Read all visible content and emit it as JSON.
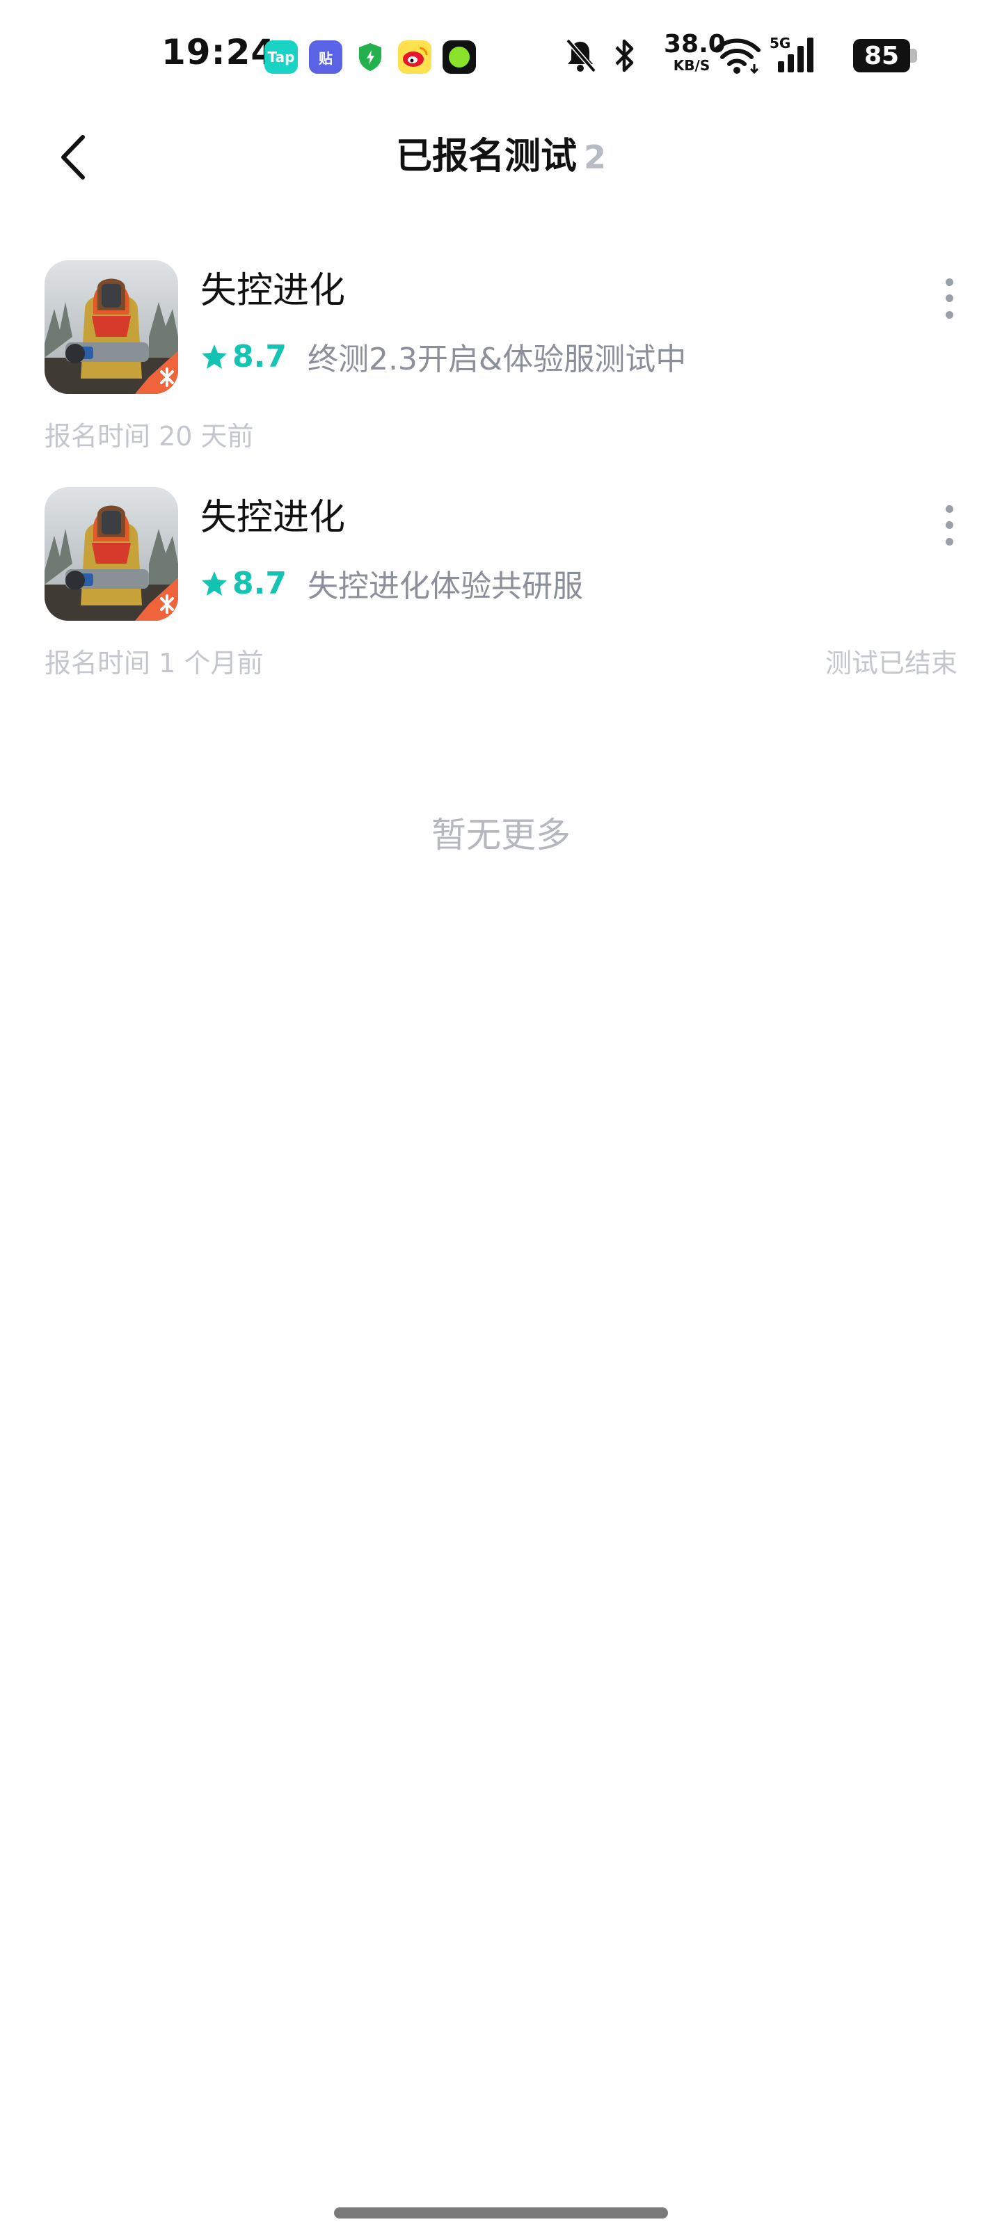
{
  "status_bar": {
    "time": "19:24",
    "notification_icons": [
      {
        "name": "tap-app-icon",
        "text": "Tap",
        "color": "#19d3c5"
      },
      {
        "name": "tieba-app-icon",
        "text": "贴",
        "color": "#4b5be0"
      },
      {
        "name": "shield-app-icon",
        "text": "",
        "color": "#22b14c"
      },
      {
        "name": "weibo-app-icon",
        "text": "",
        "color": "#f5a623"
      },
      {
        "name": "green-dot-app-icon",
        "text": "",
        "color": "#111111"
      }
    ],
    "net_speed_value": "38.0",
    "net_speed_unit": "KB/S",
    "network": "5G",
    "battery": "85"
  },
  "nav": {
    "title": "已报名测试",
    "count": "2"
  },
  "games": [
    {
      "title": "失控进化",
      "rating": "8.7",
      "test_desc": "终测2.3开启&体验服测试中",
      "signup_time": "报名时间 20 天前",
      "status": ""
    },
    {
      "title": "失控进化",
      "rating": "8.7",
      "test_desc": "失控进化体验共研服",
      "signup_time": "报名时间 1 个月前",
      "status": "测试已结束"
    }
  ],
  "footer": {
    "no_more": "暂无更多"
  },
  "colors": {
    "accent": "#14c4b2",
    "muted_text": "#8a8f99",
    "faint_text": "#c3c7cd"
  },
  "icons": {
    "back": "chevron-left-icon",
    "star": "star-icon",
    "more": "more-vertical-icon"
  }
}
